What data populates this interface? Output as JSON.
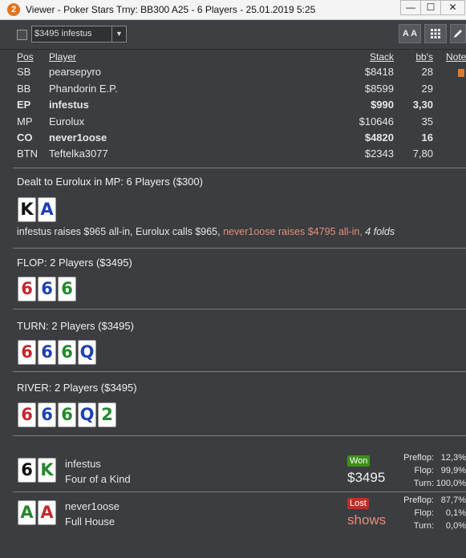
{
  "window": {
    "app_icon_glyph": "2",
    "title": "Viewer - Poker Stars Trny: BB300 A25 - 6 Players - 25.01.2019 5:25",
    "buttons": [
      "—",
      "☐",
      "✕"
    ]
  },
  "toolbar": {
    "player_select_value": "$3495 infestus",
    "font_button_label": "A A",
    "grid_button_label": "grid",
    "edit_button_label": "edit"
  },
  "table": {
    "headers": {
      "pos": "Pos",
      "player": "Player",
      "stack": "Stack",
      "bbs": "bb's",
      "notes": "Note"
    },
    "rows": [
      {
        "pos": "SB",
        "player": "pearsepyro",
        "stack": "$8418",
        "bbs": "28",
        "bold": false
      },
      {
        "pos": "BB",
        "player": "Phandorin E.P.",
        "stack": "$8599",
        "bbs": "29",
        "bold": false
      },
      {
        "pos": "EP",
        "player": "infestus",
        "stack": "$990",
        "bbs": "3,30",
        "bold": true
      },
      {
        "pos": "MP",
        "player": "Eurolux",
        "stack": "$10646",
        "bbs": "35",
        "bold": false
      },
      {
        "pos": "CO",
        "player": "never1oose",
        "stack": "$4820",
        "bbs": "16",
        "bold": true
      },
      {
        "pos": "BTN",
        "player": "Teftelka3077",
        "stack": "$2343",
        "bbs": "7,80",
        "bold": false
      }
    ]
  },
  "preflop": {
    "title": "Dealt to Eurolux in MP: 6 Players ($300)",
    "cards": [
      {
        "rank": "K",
        "color": "#111111"
      },
      {
        "rank": "A",
        "color": "#1f3fb4"
      }
    ],
    "action_plain": "infestus raises $965 all-in, Eurolux calls $965, ",
    "action_raise": "never1oose raises $4795 all-in, ",
    "action_folds": "4 folds"
  },
  "flop": {
    "title": "FLOP: 2 Players ($3495)",
    "cards": [
      {
        "rank": "6",
        "color": "#c0282d"
      },
      {
        "rank": "6",
        "color": "#1f3fb4"
      },
      {
        "rank": "6",
        "color": "#23882e"
      }
    ]
  },
  "turn": {
    "title": "TURN: 2 Players ($3495)",
    "cards": [
      {
        "rank": "6",
        "color": "#c0282d"
      },
      {
        "rank": "6",
        "color": "#1f3fb4"
      },
      {
        "rank": "6",
        "color": "#23882e"
      },
      {
        "rank": "Q",
        "color": "#1f3fb4"
      }
    ]
  },
  "river": {
    "title": "RIVER: 2 Players ($3495)",
    "cards": [
      {
        "rank": "6",
        "color": "#c0282d"
      },
      {
        "rank": "6",
        "color": "#1f3fb4"
      },
      {
        "rank": "6",
        "color": "#23882e"
      },
      {
        "rank": "Q",
        "color": "#1f3fb4"
      },
      {
        "rank": "2",
        "color": "#23882e"
      }
    ]
  },
  "results": [
    {
      "cards": [
        {
          "rank": "6",
          "color": "#111111"
        },
        {
          "rank": "K",
          "color": "#23882e"
        }
      ],
      "player": "infestus",
      "hand": "Four of a Kind",
      "badge": "Won",
      "badge_color": "#3f8f1f",
      "amount": "$3495",
      "amount_color": "#f0f0f0",
      "equity": [
        {
          "label": "Preflop:",
          "value": "12,3%"
        },
        {
          "label": "Flop:",
          "value": "99,9%"
        },
        {
          "label": "Turn:",
          "value": "100,0%"
        }
      ]
    },
    {
      "cards": [
        {
          "rank": "A",
          "color": "#23882e"
        },
        {
          "rank": "A",
          "color": "#c0282d"
        }
      ],
      "player": "never1oose",
      "hand": "Full House",
      "badge": "Lost",
      "badge_color": "#b83226",
      "amount": "shows",
      "amount_color": "#e78d79",
      "equity": [
        {
          "label": "Preflop:",
          "value": "87,7%"
        },
        {
          "label": "Flop:",
          "value": "0,1%"
        },
        {
          "label": "Turn:",
          "value": "0,0%"
        }
      ]
    }
  ]
}
